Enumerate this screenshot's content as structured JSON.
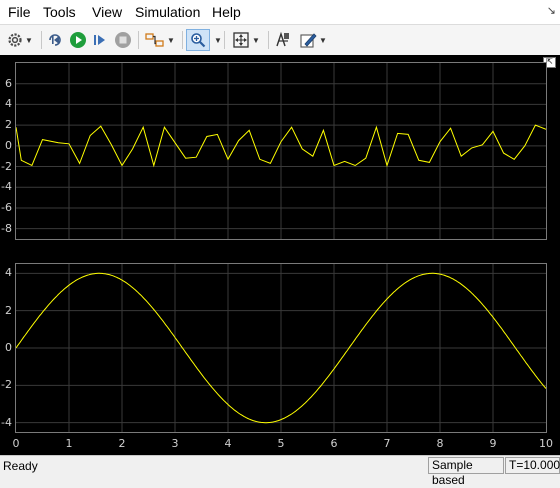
{
  "menubar": {
    "items": [
      "File",
      "Tools",
      "View",
      "Simulation",
      "Help"
    ],
    "corner_icon": "undock-arrow-icon"
  },
  "toolbar": {
    "buttons": [
      {
        "name": "settings-icon",
        "color": "#4a4a4a",
        "dropdown": true
      },
      {
        "name": "step-back-icon",
        "color": "#3b5b8a"
      },
      {
        "name": "run-icon",
        "color": "#1f9e3c"
      },
      {
        "name": "step-forward-icon",
        "color": "#3b6fb5"
      },
      {
        "name": "stop-icon",
        "color": "#a0a0a0"
      },
      {
        "name": "highlight-signal-icon",
        "color": "#d07a1a",
        "dropdown": true
      },
      {
        "name": "zoom-icon",
        "color": "#2a5d9f",
        "dropdown": true,
        "pressed": true
      },
      {
        "name": "fit-to-view-icon",
        "color": "#333333",
        "dropdown": true
      },
      {
        "name": "cursor-measurements-icon",
        "color": "#333333"
      },
      {
        "name": "style-icon",
        "color": "#2a5d9f",
        "dropdown": true
      }
    ]
  },
  "plot": {
    "background": "#000000",
    "line_color": "#ffff00",
    "grid_color": "#3a3a3a",
    "tick_color": "#d0d0d0"
  },
  "chart_data": [
    {
      "type": "line",
      "title": "",
      "xlabel": "",
      "ylabel": "",
      "xlim": [
        0,
        10
      ],
      "ylim": [
        -9,
        8
      ],
      "yticks": [
        "6",
        "4",
        "2",
        "0",
        "-2",
        "-4",
        "-6",
        "-8"
      ],
      "ytick_values": [
        6,
        4,
        2,
        0,
        -2,
        -4,
        -6,
        -8
      ],
      "grid": true,
      "series": [
        {
          "x": [
            0,
            0.1,
            0.3,
            0.5,
            0.8,
            1.0,
            1.2,
            1.4,
            1.6,
            1.8,
            2.0,
            2.2,
            2.4,
            2.6,
            2.8,
            3.0,
            3.2,
            3.4,
            3.6,
            3.8,
            4.0,
            4.2,
            4.4,
            4.6,
            4.8,
            5.0,
            5.2,
            5.4,
            5.6,
            5.8,
            6.0,
            6.2,
            6.4,
            6.6,
            6.8,
            7.0,
            7.2,
            7.4,
            7.6,
            7.8,
            8.0,
            8.2,
            8.4,
            8.6,
            8.8,
            9.0,
            9.2,
            9.4,
            9.6,
            9.8,
            10.0
          ],
          "y": [
            1.8,
            -1.4,
            -1.9,
            0.6,
            0.3,
            0.2,
            -1.7,
            1.0,
            1.9,
            0.1,
            -1.9,
            -0.3,
            1.8,
            -1.9,
            1.8,
            0.3,
            -1.2,
            -1.1,
            0.9,
            1.1,
            -1.3,
            0.5,
            1.5,
            -1.3,
            -1.7,
            0.4,
            1.8,
            -0.3,
            -1.0,
            1.5,
            -1.9,
            -1.5,
            -1.9,
            -1.2,
            1.8,
            -1.9,
            1.2,
            1.1,
            -1.4,
            -1.6,
            0.4,
            1.7,
            -1.0,
            -0.2,
            0.1,
            1.4,
            -0.7,
            -1.3,
            0.0,
            2.0,
            1.6
          ]
        }
      ]
    },
    {
      "type": "line",
      "title": "",
      "xlabel": "",
      "ylabel": "",
      "xlim": [
        0,
        10
      ],
      "ylim": [
        -4.5,
        4.5
      ],
      "yticks": [
        "4",
        "2",
        "0",
        "-2",
        "-4"
      ],
      "ytick_values": [
        4,
        2,
        0,
        -2,
        -4
      ],
      "xticks": [
        "0",
        "1",
        "2",
        "3",
        "4",
        "5",
        "6",
        "7",
        "8",
        "9",
        "10"
      ],
      "xtick_values": [
        0,
        1,
        2,
        3,
        4,
        5,
        6,
        7,
        8,
        9,
        10
      ],
      "grid": true,
      "series": [
        {
          "function": "4*sin(t)",
          "amplitude": 4,
          "x_start": 0,
          "x_end": 10
        }
      ]
    }
  ],
  "status": {
    "left": "Ready",
    "mode": "Sample based",
    "time": "T=10.000"
  }
}
